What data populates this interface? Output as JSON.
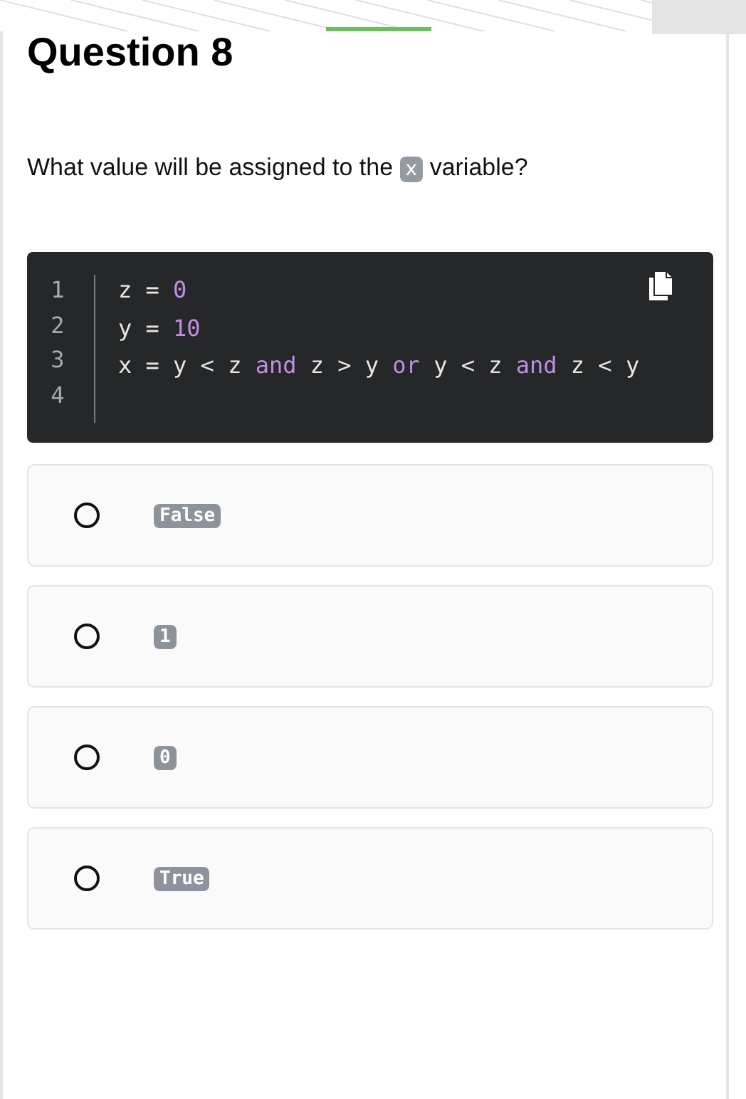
{
  "title": "Question 8",
  "prompt": [
    {
      "kind": "text",
      "text": "What value will be assigned to the"
    },
    {
      "kind": "code",
      "text": "x"
    },
    {
      "kind": "text",
      "text": "variable?"
    }
  ],
  "code": {
    "lines": [
      {
        "number": "1",
        "tokens": [
          {
            "kind": "plain",
            "text": "z = "
          },
          {
            "kind": "number",
            "text": "0"
          }
        ]
      },
      {
        "number": "2",
        "tokens": [
          {
            "kind": "plain",
            "text": "y = "
          },
          {
            "kind": "number",
            "text": "10"
          }
        ]
      },
      {
        "number": "3",
        "tokens": [
          {
            "kind": "plain",
            "text": "x = y < z "
          },
          {
            "kind": "keyword",
            "text": "and"
          },
          {
            "kind": "plain",
            "text": " z > y "
          },
          {
            "kind": "keyword",
            "text": "or"
          },
          {
            "kind": "plain",
            "text": " y < z "
          },
          {
            "kind": "keyword",
            "text": "and"
          },
          {
            "kind": "plain",
            "text": " z < y"
          }
        ]
      },
      {
        "number": "4"
      }
    ]
  },
  "options": [
    {
      "label": "False",
      "selected": false
    },
    {
      "label": "1",
      "selected": false
    },
    {
      "label": "0",
      "selected": false
    },
    {
      "label": "True",
      "selected": false
    }
  ]
}
